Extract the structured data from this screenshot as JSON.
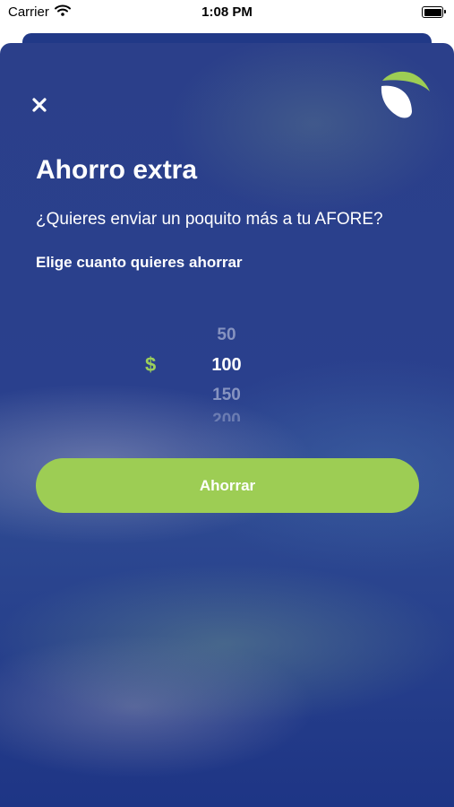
{
  "status_bar": {
    "carrier": "Carrier",
    "time": "1:08 PM"
  },
  "modal": {
    "title": "Ahorro extra",
    "subtitle": "¿Quieres enviar un poquito más a tu AFORE?",
    "prompt": "Elige cuanto quieres ahorrar",
    "currency_symbol": "$",
    "amount_options": [
      "50",
      "100",
      "150",
      "200"
    ],
    "selected_amount": "100",
    "save_button_label": "Ahorrar"
  },
  "colors": {
    "accent_green": "#9dcd54",
    "sheet_blue": "#2a408d",
    "text_white": "#ffffff"
  },
  "icons": {
    "close": "close-icon",
    "logo": "leaf-logo-icon",
    "wifi": "wifi-icon",
    "battery": "battery-icon"
  }
}
